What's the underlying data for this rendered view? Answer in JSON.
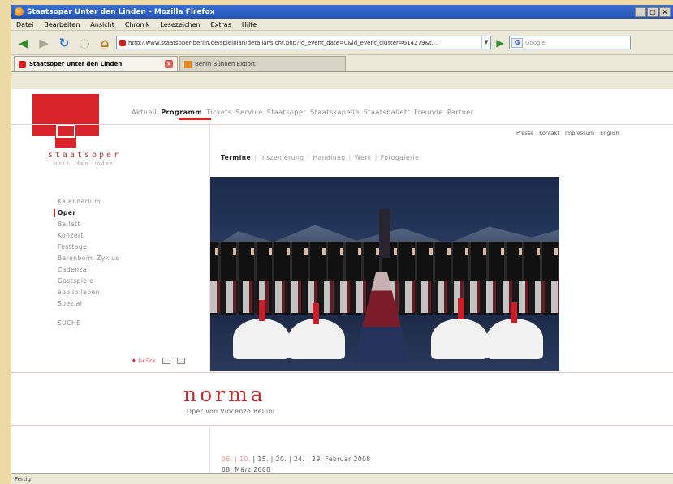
{
  "window": {
    "title": "Staatsoper Unter den Linden - Mozilla Firefox",
    "controls": [
      "_",
      "□",
      "×"
    ]
  },
  "menu": [
    "Datei",
    "Bearbeiten",
    "Ansicht",
    "Chronik",
    "Lesezeichen",
    "Extras",
    "Hilfe"
  ],
  "toolbar": {
    "url": "http://www.staatsoper-berlin.de/spielplan/detailansicht.php?id_event_date=0&id_event_cluster=614279&t...",
    "search_placeholder": "Google"
  },
  "tabs": [
    {
      "label": "Staatsoper Unter den Linden",
      "active": true
    },
    {
      "label": "Berlin Bühnen Export",
      "active": false
    }
  ],
  "site": {
    "logo_text": "staatsoper",
    "logo_sub": "unter den linden",
    "mainnav": [
      "Aktuell",
      "Programm",
      "Tickets",
      "Service",
      "Staatsoper",
      "Staatskapelle",
      "Staatsballett",
      "Freunde",
      "Partner"
    ],
    "utilnav": [
      "Presse",
      "Kontakt",
      "Impressum",
      "English"
    ],
    "subnav": [
      "Termine",
      "Inszenierung",
      "Handlung",
      "Werk",
      "Fotogalerie"
    ],
    "sidenav": [
      "Kalendarium",
      "Oper",
      "Ballett",
      "Konzert",
      "Festtage",
      "Barenboim Zyklus",
      "Cadenza",
      "Gastspiele",
      "apollo:leben",
      "Spezial"
    ],
    "suche": "SUCHE",
    "zurueck": "♦ zurück",
    "opera_title": "norma",
    "opera_subtitle": "Oper von Vincenzo Bellini",
    "dates_line1": {
      "past": "06. | 10.",
      "upcoming": " | 15. | 20. | 24. | 29. Februar 2008"
    },
    "dates_line2": "08. März 2008"
  },
  "status": "Fertig",
  "colors": {
    "brand_red": "#d8242a",
    "title_red": "#c03033",
    "past_date": "#e08a7a"
  }
}
